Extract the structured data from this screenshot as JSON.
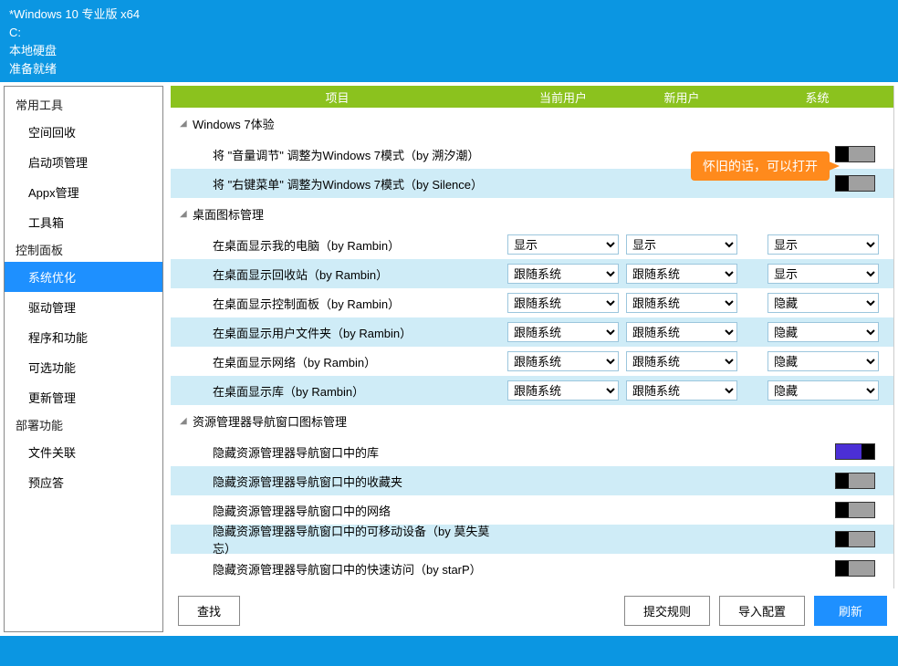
{
  "header": {
    "title": "*Windows 10 专业版 x64",
    "drive": "C:",
    "disk": "本地硬盘",
    "status": "准备就绪"
  },
  "sidebar": {
    "groups": [
      {
        "title": "常用工具",
        "items": [
          "空间回收",
          "启动项管理",
          "Appx管理",
          "工具箱"
        ]
      },
      {
        "title": "控制面板",
        "items": [
          "系统优化",
          "驱动管理",
          "程序和功能",
          "可选功能",
          "更新管理"
        ],
        "selected": 0
      },
      {
        "title": "部署功能",
        "items": [
          "文件关联",
          "预应答"
        ]
      }
    ]
  },
  "table_headers": {
    "item": "项目",
    "cur": "当前用户",
    "new": "新用户",
    "sys": "系统"
  },
  "groups": [
    {
      "title": "Windows 7体验",
      "rows": [
        {
          "label": "将 \"音量调节\" 调整为Windows 7模式（by 溯汐潮）",
          "type": "toggle",
          "sys": "off"
        },
        {
          "label": "将 \"右键菜单\" 调整为Windows 7模式（by Silence）",
          "type": "toggle",
          "sys": "off",
          "alt": true
        }
      ]
    },
    {
      "title": "桌面图标管理",
      "rows": [
        {
          "label": "在桌面显示我的电脑（by Rambin）",
          "type": "select",
          "cur": "显示",
          "new": "显示",
          "sys": "显示"
        },
        {
          "label": "在桌面显示回收站（by Rambin）",
          "type": "select",
          "cur": "跟随系统",
          "new": "跟随系统",
          "sys": "显示",
          "alt": true
        },
        {
          "label": "在桌面显示控制面板（by Rambin）",
          "type": "select",
          "cur": "跟随系统",
          "new": "跟随系统",
          "sys": "隐藏"
        },
        {
          "label": "在桌面显示用户文件夹（by Rambin）",
          "type": "select",
          "cur": "跟随系统",
          "new": "跟随系统",
          "sys": "隐藏",
          "alt": true
        },
        {
          "label": "在桌面显示网络（by Rambin）",
          "type": "select",
          "cur": "跟随系统",
          "new": "跟随系统",
          "sys": "隐藏"
        },
        {
          "label": "在桌面显示库（by Rambin）",
          "type": "select",
          "cur": "跟随系统",
          "new": "跟随系统",
          "sys": "隐藏",
          "alt": true
        }
      ]
    },
    {
      "title": "资源管理器导航窗口图标管理",
      "rows": [
        {
          "label": "隐藏资源管理器导航窗口中的库",
          "type": "toggle",
          "sys": "on"
        },
        {
          "label": "隐藏资源管理器导航窗口中的收藏夹",
          "type": "toggle",
          "sys": "off",
          "alt": true
        },
        {
          "label": "隐藏资源管理器导航窗口中的网络",
          "type": "toggle",
          "sys": "off"
        },
        {
          "label": "隐藏资源管理器导航窗口中的可移动设备（by 莫失莫忘）",
          "type": "toggle",
          "sys": "off",
          "alt": true
        },
        {
          "label": "隐藏资源管理器导航窗口中的快速访问（by starP）",
          "type": "toggle",
          "sys": "off"
        }
      ]
    }
  ],
  "callout": "怀旧的话，可以打开",
  "buttons": {
    "find": "查找",
    "submit": "提交规则",
    "import": "导入配置",
    "refresh": "刷新"
  }
}
